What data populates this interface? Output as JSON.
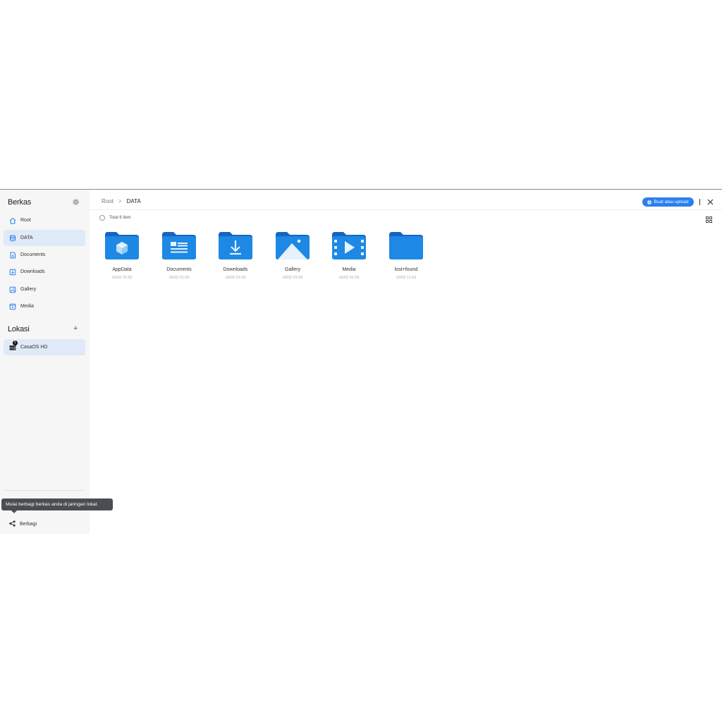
{
  "sidebar": {
    "title": "Berkas",
    "settings_icon": "gear-icon",
    "items": [
      {
        "label": "Root",
        "icon": "home-icon"
      },
      {
        "label": "DATA",
        "icon": "database-icon"
      },
      {
        "label": "Documents",
        "icon": "document-icon"
      },
      {
        "label": "Downloads",
        "icon": "download-icon"
      },
      {
        "label": "Gallery",
        "icon": "image-icon"
      },
      {
        "label": "Media",
        "icon": "media-icon"
      }
    ],
    "locations_title": "Lokasi",
    "add_icon": "plus-icon",
    "locations": [
      {
        "label": "CasaOS HD",
        "icon": "drive-icon",
        "badge": "1"
      }
    ],
    "tooltip": "Mulai berbagi berkas anda di jaringan lokal.",
    "share_label": "Berbagi"
  },
  "header": {
    "breadcrumb": [
      "Root",
      "DATA"
    ],
    "breadcrumb_sep": ">",
    "upload_label": "Buat atau upload",
    "total": "Total 6 item"
  },
  "colors": {
    "accent": "#2a7ef0",
    "folder_back": "#1565c0",
    "folder_front": "#1e88e5"
  },
  "folders": [
    {
      "name": "AppData",
      "date": "16/02 01:55",
      "icon": "cube-icon"
    },
    {
      "name": "Documents",
      "date": "16/02 01:55",
      "icon": "document-lines-icon"
    },
    {
      "name": "Downloads",
      "date": "16/02 01:55",
      "icon": "download-arrow-icon"
    },
    {
      "name": "Gallery",
      "date": "16/02 01:55",
      "icon": "mountain-icon"
    },
    {
      "name": "Media",
      "date": "16/02 01:55",
      "icon": "play-film-icon"
    },
    {
      "name": "lost+found",
      "date": "16/02 11:52",
      "icon": "plain-folder-icon"
    }
  ]
}
